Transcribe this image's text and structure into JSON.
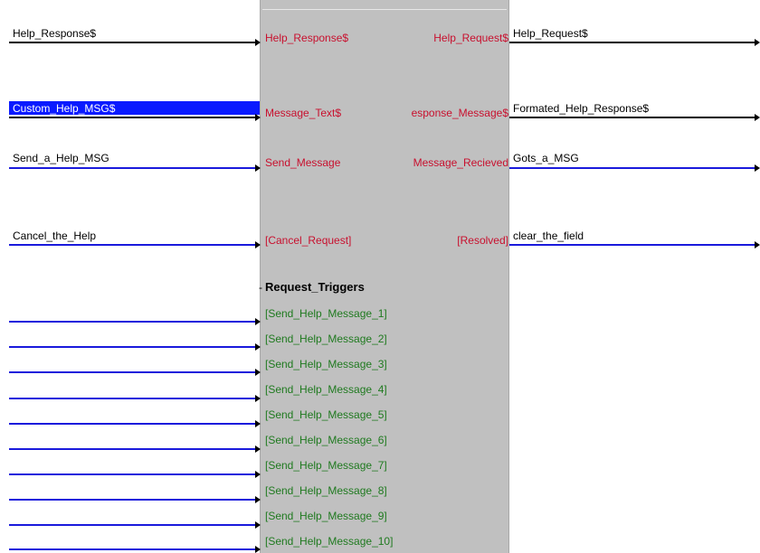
{
  "colors": {
    "block_bg": "#c0c0c0",
    "port_text": "#c8102e",
    "trigger_text": "#1f7a1f",
    "wire_black": "#000000",
    "wire_blue": "#1a1adc",
    "selection": "#0a1aff"
  },
  "left_wires": [
    "Help_Response$",
    "Custom_Help_MSG$",
    "Send_a_Help_MSG",
    "Cancel_the_Help"
  ],
  "block": {
    "inputs": [
      "Help_Response$",
      "Message_Text$",
      "Send_Message",
      "[Cancel_Request]"
    ],
    "outputs": [
      "Help_Request$",
      "esponse_Message$",
      "Message_Recieved",
      "[Resolved]"
    ],
    "group_header": "Request_Triggers",
    "group_dash": "-",
    "triggers": [
      "[Send_Help_Message_1]",
      "[Send_Help_Message_2]",
      "[Send_Help_Message_3]",
      "[Send_Help_Message_4]",
      "[Send_Help_Message_5]",
      "[Send_Help_Message_6]",
      "[Send_Help_Message_7]",
      "[Send_Help_Message_8]",
      "[Send_Help_Message_9]",
      "[Send_Help_Message_10]"
    ]
  },
  "right_wires": [
    "Help_Request$",
    "Formated_Help_Response$",
    "Gots_a_MSG",
    "clear_the_field"
  ]
}
